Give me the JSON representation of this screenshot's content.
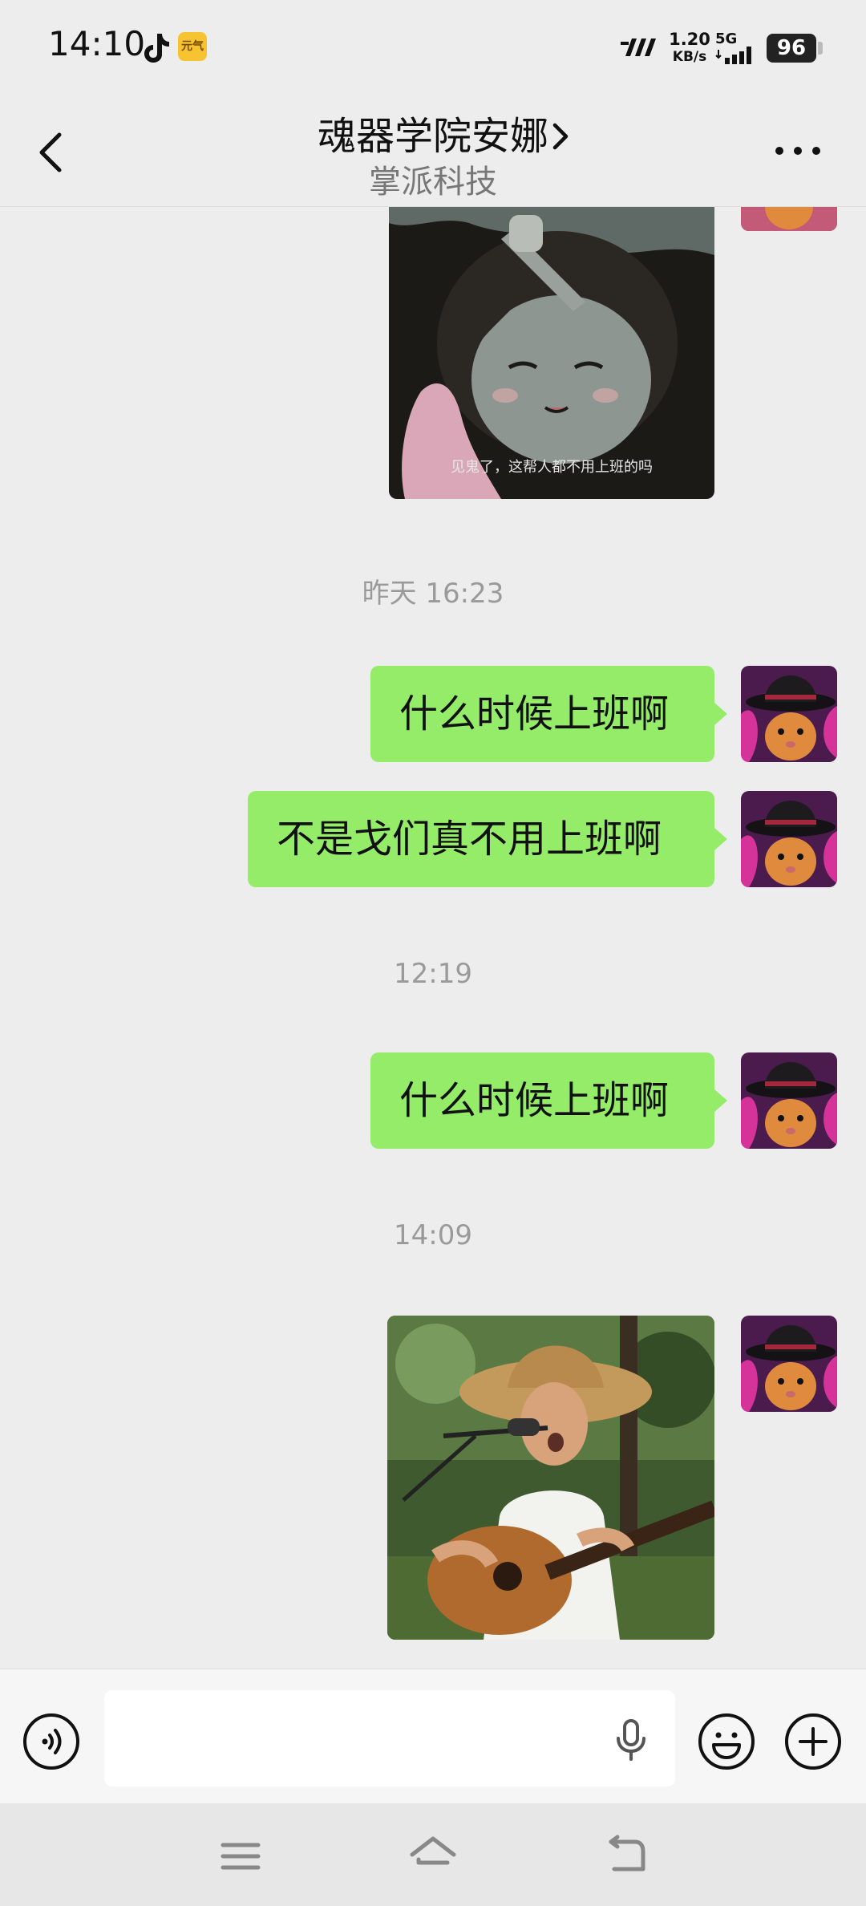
{
  "status_bar": {
    "time": "14:10",
    "app_badge": "元气",
    "net_speed_value": "1.20",
    "net_speed_unit": "KB/s",
    "network_type": "5G",
    "battery": "96"
  },
  "header": {
    "title": "魂器学院安娜",
    "subtitle": "掌派科技",
    "icons": {
      "back": "back-arrow-icon",
      "chevron": "chevron-right-icon",
      "more": "more-dots-icon"
    }
  },
  "messages": [
    {
      "type": "image",
      "sender": "me",
      "caption": "见鬼了，这帮人都不用上班的吗",
      "depicts": "anime-character-sticker"
    },
    {
      "type": "timestamp",
      "text": "昨天 16:23"
    },
    {
      "type": "text",
      "sender": "me",
      "text": "什么时候上班啊"
    },
    {
      "type": "text",
      "sender": "me",
      "text": "不是戈们真不用上班啊"
    },
    {
      "type": "timestamp",
      "text": "12:19"
    },
    {
      "type": "text",
      "sender": "me",
      "text": "什么时候上班啊"
    },
    {
      "type": "timestamp",
      "text": "14:09"
    },
    {
      "type": "image",
      "sender": "me",
      "caption": "",
      "depicts": "singer-with-guitar-photo"
    }
  ],
  "input_bar": {
    "value": "",
    "placeholder": "",
    "icons": {
      "voice": "voice-icon",
      "mic": "mic-icon",
      "emoji": "emoji-icon",
      "plus": "plus-icon"
    }
  },
  "nav_bar": {
    "icons": [
      "menu-icon",
      "home-icon",
      "back-icon"
    ]
  },
  "colors": {
    "background": "#ededed",
    "bubble_me": "#95ec69",
    "timestamp": "#9a9a9a",
    "battery_bg": "#222222",
    "app_badge": "#f7c331"
  }
}
